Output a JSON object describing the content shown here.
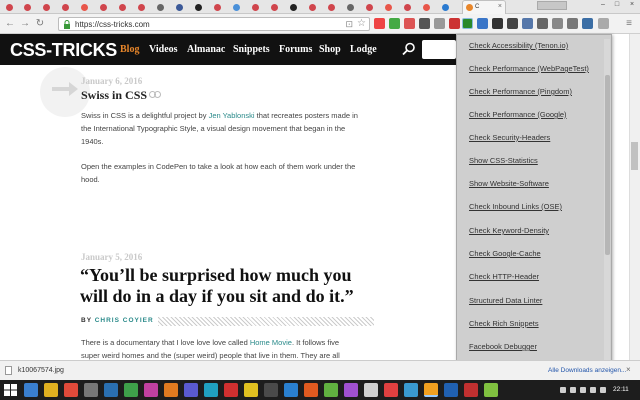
{
  "browser": {
    "active_tab_label": "C",
    "profile_badge": "",
    "url": "https://css-tricks.com"
  },
  "site": {
    "logo": "CSS-TRICKS",
    "nav": [
      "Blog",
      "Videos",
      "Almanac",
      "Snippets",
      "Forums",
      "Shop",
      "Lodge"
    ]
  },
  "posts": [
    {
      "date": "January 6, 2016",
      "title": "Swiss in CSS",
      "para1_pre": "Swiss in CSS is a delightful project by ",
      "para1_link": "Jen Yablonski",
      "para1_line1_post": " that recreates posters made in",
      "para1_line2": "the International Typographic Style, a visual design movement that began in the",
      "para1_line3": "1940s.",
      "para2_line1": "Open the examples in CodePen to take a look at how each of them work under the",
      "para2_line2": "hood."
    },
    {
      "date": "January 5, 2016",
      "title_line1": "“You’ll be surprised how much you",
      "title_line2": "will do in a day if you sit and do it.”",
      "byline_prefix": "BY ",
      "author": "CHRIS COYIER",
      "para_pre": "There is a documentary that I love love love called ",
      "para_link": "Home Movie",
      "para_post": ". It follows five",
      "para_line2": "super weird homes and the (super weird) people that live in them. They are all"
    }
  ],
  "extension_menu": {
    "items": [
      "Check Accessibility (Tenon.io)",
      "Check Performance (WebPageTest)",
      "Check Performance (Pingdom)",
      "Check Performance (Google)",
      "Check Security-Headers",
      "Show CSS-Statistics",
      "Show Website-Software",
      "Check Inbound Links (OSE)",
      "Check Keyword-Density",
      "Check Google-Cache",
      "Check HTTP-Header",
      "Structured Data Linter",
      "Check Rich Snippets",
      "Facebook Debugger"
    ]
  },
  "download_shelf": {
    "file_name": "k10067574.jpg",
    "show_all": "Alle Downloads anzeigen..."
  },
  "taskbar": {
    "clock": "22:11"
  }
}
